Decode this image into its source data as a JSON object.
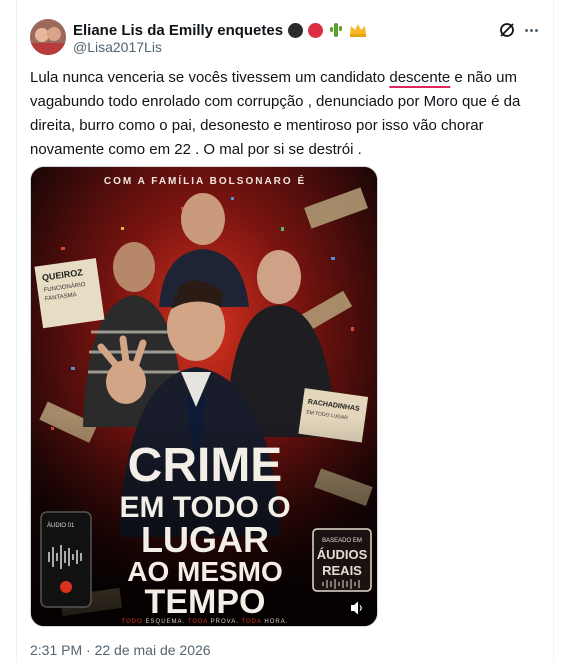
{
  "tweet": {
    "display_name": "Eliane Lis da Emilly enquetes",
    "handle": "@Lisa2017Lis",
    "text_before": "Lula nunca venceria se vocês tivessem um candidato ",
    "text_underlined": "descente",
    "text_after": " e não um vagabundo todo enrolado com corrupção , denunciado por Moro que é da direita, burro como o pai, desonesto e mentiroso por isso vão chorar novamente como em 22 . O mal por si se destrói .",
    "timestamp": "2:31 PM · 22 de mai de 2026"
  },
  "poster": {
    "tagline": "COM A FAMÍLIA BOLSONARO É",
    "title_lines": [
      "CRIME",
      "EM TODO O",
      "LUGAR",
      "AO MESMO",
      "TEMPO"
    ],
    "bottom_line_parts": [
      "TODO",
      " ESQUEMA. ",
      "TODA",
      " PROVA. ",
      "TODA",
      " HORA."
    ],
    "badge_lines": [
      "BASEADO EM",
      "ÁUDIOS",
      "REAIS"
    ],
    "doc_left_lines": [
      "QUEIROZ",
      "FUNCIONÁRIO",
      "FANTASMA"
    ],
    "doc_right_lines": [
      "RACHADINHAS",
      "EM TODO LUGAR"
    ],
    "phone_label": "ÁUDIO 01"
  },
  "colors": {
    "text": "#0f1419",
    "secondary": "#536471",
    "border": "#eff3f4",
    "underline": "#e0245e",
    "poster_red": "#c0231e"
  },
  "icons": {
    "grok": "grok-icon",
    "more": "more-icon",
    "volume": "volume-icon"
  }
}
